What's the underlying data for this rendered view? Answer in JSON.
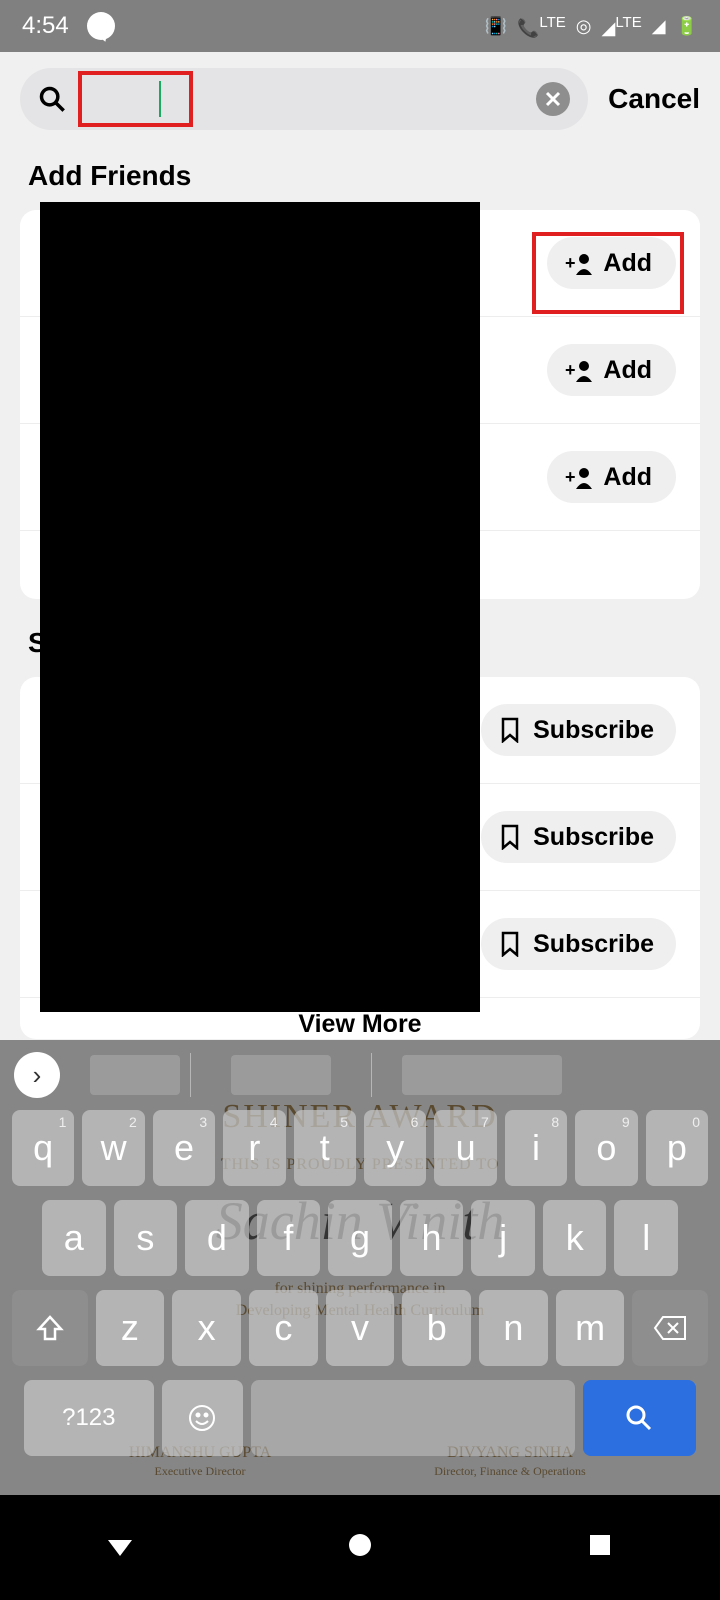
{
  "status": {
    "time": "4:54",
    "lte": "LTE",
    "lte2": "LTE"
  },
  "search": {
    "cancel": "Cancel"
  },
  "sections": {
    "add_friends": {
      "title": "Add Friends"
    },
    "subscribe": {
      "title_partial": "S"
    }
  },
  "buttons": {
    "add": "Add",
    "subscribe": "Subscribe",
    "view_more": "View More"
  },
  "keyboard": {
    "row1": [
      "q",
      "w",
      "e",
      "r",
      "t",
      "y",
      "u",
      "i",
      "o",
      "p"
    ],
    "nums": [
      "1",
      "2",
      "3",
      "4",
      "5",
      "6",
      "7",
      "8",
      "9",
      "0"
    ],
    "row2": [
      "a",
      "s",
      "d",
      "f",
      "g",
      "h",
      "j",
      "k",
      "l"
    ],
    "row3": [
      "z",
      "x",
      "c",
      "v",
      "b",
      "n",
      "m"
    ],
    "sym": "?123"
  },
  "cert": {
    "l1": "SHINER AWARD",
    "l2": "THIS IS PROUDLY PRESENTED TO",
    "l3": "Sachin Vinith",
    "l4": "for shining performance in",
    "l5": "Developing Mental Health Curriculum",
    "s1": "HIMANSHU GUPTA",
    "s1b": "Executive Director",
    "s2": "DIVYANG SINHA",
    "s2b": "Director, Finance & Operations"
  }
}
